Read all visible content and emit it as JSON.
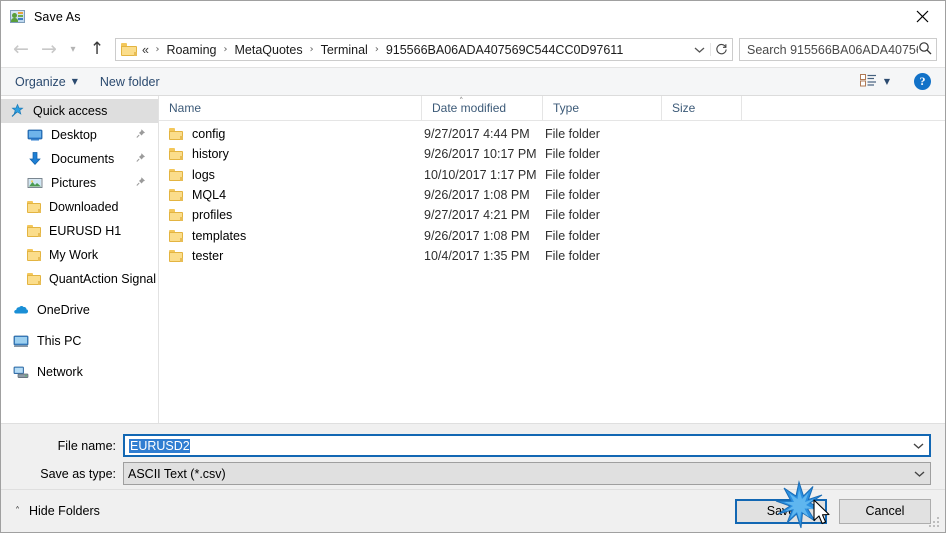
{
  "window": {
    "title": "Save As",
    "icon": "save-as-app-icon",
    "close_label": "✕"
  },
  "nav": {
    "back": "back-arrow",
    "forward": "forward-arrow",
    "recent": "recent-locations-chevron",
    "up": "up-arrow",
    "address": {
      "folder_icon": "folder-icon",
      "prefix": "«",
      "crumbs": [
        "Roaming",
        "MetaQuotes",
        "Terminal",
        "915566BA06ADA407569C544CC0D97611"
      ],
      "separator": "›",
      "dropdown": "chevron-down-icon",
      "refresh": "refresh-icon"
    },
    "search": {
      "placeholder": "Search 915566BA06ADA40756...",
      "icon": "search-icon"
    }
  },
  "toolbar": {
    "organize_label": "Organize",
    "organize_caret": "▼",
    "new_folder_label": "New folder",
    "view_icon": "view-layout-icon",
    "view_caret": "▼",
    "help_label": "?"
  },
  "sidebar": {
    "items": [
      {
        "label": "Quick access",
        "icon": "star-pin-icon",
        "selected": true,
        "indent": false,
        "group": false,
        "pinned": false
      },
      {
        "label": "Desktop",
        "icon": "desktop-icon",
        "selected": false,
        "indent": true,
        "group": false,
        "pinned": true
      },
      {
        "label": "Documents",
        "icon": "documents-download-icon",
        "selected": false,
        "indent": true,
        "group": false,
        "pinned": true
      },
      {
        "label": "Pictures",
        "icon": "pictures-icon",
        "selected": false,
        "indent": true,
        "group": false,
        "pinned": true
      },
      {
        "label": "Downloaded",
        "icon": "folder-icon",
        "selected": false,
        "indent": true,
        "group": false,
        "pinned": false
      },
      {
        "label": "EURUSD H1",
        "icon": "folder-icon",
        "selected": false,
        "indent": true,
        "group": false,
        "pinned": false
      },
      {
        "label": "My Work",
        "icon": "folder-icon",
        "selected": false,
        "indent": true,
        "group": false,
        "pinned": false
      },
      {
        "label": "QuantAction Signal",
        "icon": "folder-icon",
        "selected": false,
        "indent": true,
        "group": false,
        "pinned": false
      },
      {
        "label": "OneDrive",
        "icon": "onedrive-cloud-icon",
        "selected": false,
        "indent": false,
        "group": true,
        "pinned": false
      },
      {
        "label": "This PC",
        "icon": "this-pc-icon",
        "selected": false,
        "indent": false,
        "group": true,
        "pinned": false
      },
      {
        "label": "Network",
        "icon": "network-icon",
        "selected": false,
        "indent": false,
        "group": true,
        "pinned": false
      }
    ],
    "pin_glyph": "📌"
  },
  "filelist": {
    "columns": [
      "Name",
      "Date modified",
      "Type",
      "Size"
    ],
    "sort_indicator": "˄",
    "rows": [
      {
        "name": "config",
        "date": "9/27/2017 4:44 PM",
        "type": "File folder",
        "size": ""
      },
      {
        "name": "history",
        "date": "9/26/2017 10:17 PM",
        "type": "File folder",
        "size": ""
      },
      {
        "name": "logs",
        "date": "10/10/2017 1:17 PM",
        "type": "File folder",
        "size": ""
      },
      {
        "name": "MQL4",
        "date": "9/26/2017 1:08 PM",
        "type": "File folder",
        "size": ""
      },
      {
        "name": "profiles",
        "date": "9/27/2017 4:21 PM",
        "type": "File folder",
        "size": ""
      },
      {
        "name": "templates",
        "date": "9/26/2017 1:08 PM",
        "type": "File folder",
        "size": ""
      },
      {
        "name": "tester",
        "date": "10/4/2017 1:35 PM",
        "type": "File folder",
        "size": ""
      }
    ]
  },
  "form": {
    "filename_label": "File name:",
    "filename_value": "EURUSD2",
    "filetype_label": "Save as type:",
    "filetype_value": "ASCII Text (*.csv)",
    "chevron": "chevron-down-icon"
  },
  "footer": {
    "hide_folders_label": "Hide Folders",
    "hide_folders_caret": "˄",
    "save_label": "Save",
    "cancel_label": "Cancel",
    "resize_grip": "resize-grip"
  },
  "colors": {
    "accent": "#1267b3",
    "selection": "#2f7dd1",
    "folder": "#fbdd8b",
    "toolbar_link": "#2b4a6f",
    "help_blue": "#1272c8",
    "sidebar_selected": "#dedede"
  }
}
